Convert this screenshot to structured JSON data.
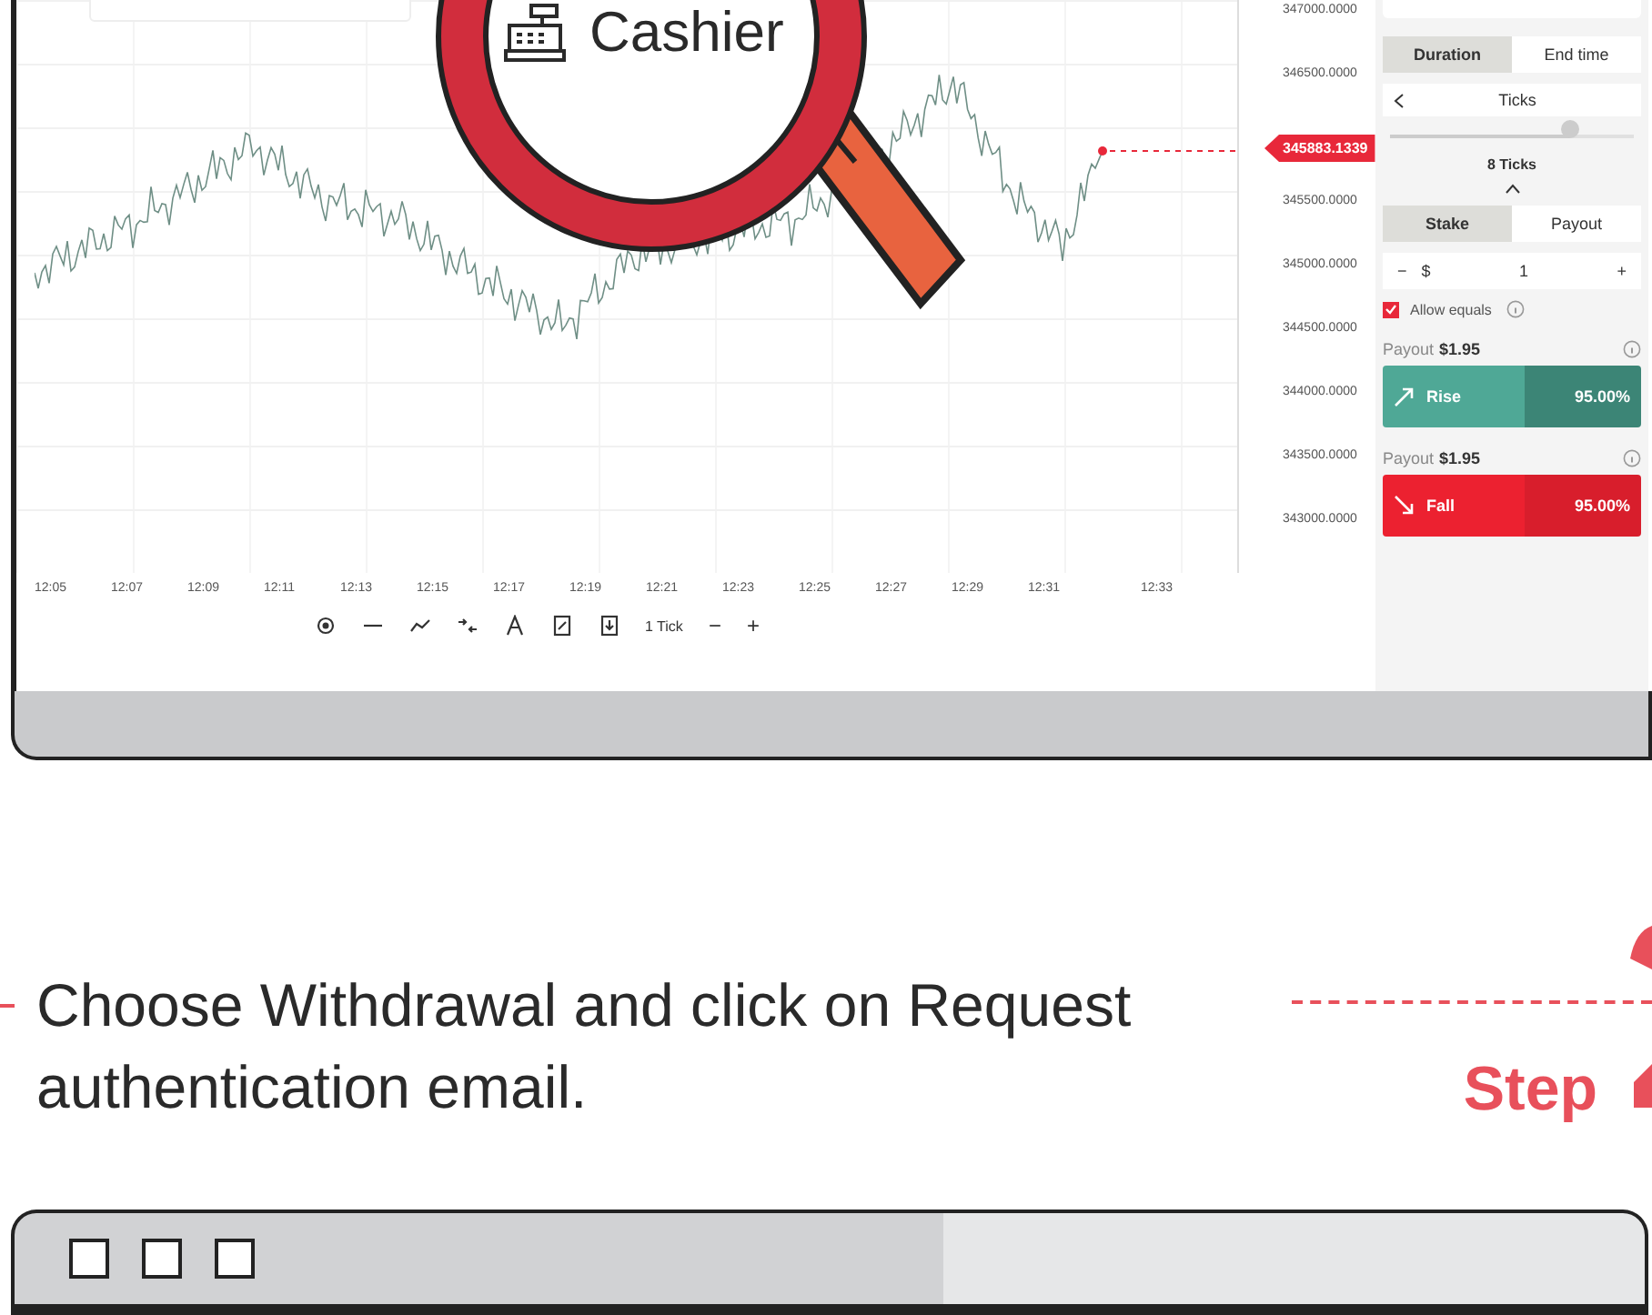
{
  "magnifier": {
    "label": "Cashier"
  },
  "chart": {
    "y_axis_labels": [
      "347000.0000",
      "346500.0000",
      "345500.0000",
      "345000.0000",
      "344500.0000",
      "344000.0000",
      "343500.0000",
      "343000.0000"
    ],
    "current_price": "345883.1339",
    "x_axis_labels": [
      "12:05",
      "12:07",
      "12:09",
      "12:11",
      "12:13",
      "12:15",
      "12:17",
      "12:19",
      "12:21",
      "12:23",
      "12:25",
      "12:27",
      "12:29",
      "12:31",
      "12:33"
    ]
  },
  "toolbar": {
    "interval": "1 Tick",
    "zoom_out": "−",
    "zoom_in": "+"
  },
  "trade_panel": {
    "duration_tabs": [
      {
        "label": "Duration",
        "selected": true
      },
      {
        "label": "End time",
        "selected": false
      }
    ],
    "unit": "Ticks",
    "duration": {
      "level": 0.74,
      "value": "8 Ticks"
    },
    "stake_tabs": [
      {
        "label": "Stake",
        "selected": true
      },
      {
        "label": "Payout",
        "selected": false
      }
    ],
    "stake": {
      "minus": "−",
      "currency": "$",
      "value": "1",
      "plus": "+"
    },
    "allow_equals": {
      "label": "Allow equals",
      "checked": true
    },
    "contracts": [
      {
        "kind": "rise",
        "payout_label": "Payout",
        "payout": "$1.95",
        "label": "Rise",
        "percent": "95.00%"
      },
      {
        "kind": "fall",
        "payout_label": "Payout",
        "payout": "$1.95",
        "label": "Fall",
        "percent": "95.00%"
      }
    ]
  },
  "instruction": {
    "text": "Choose Withdrawal and click on Request authentication email.",
    "step_label": "Step"
  }
}
